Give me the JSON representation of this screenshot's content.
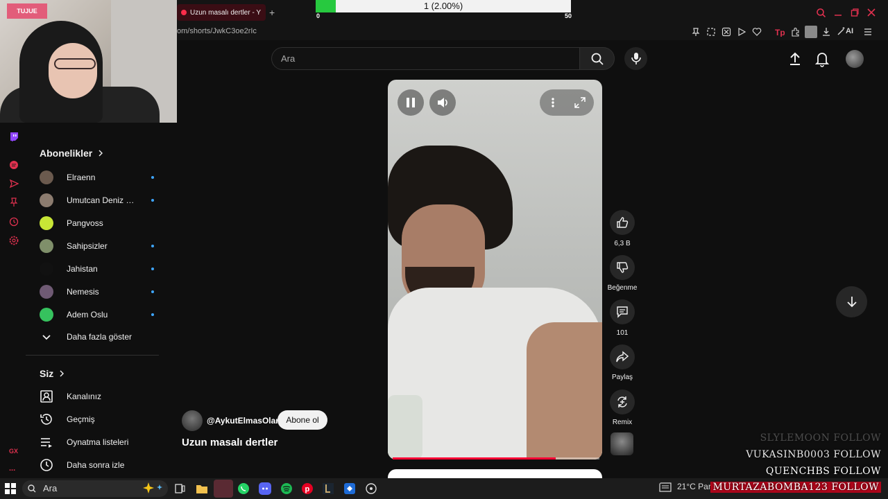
{
  "browser": {
    "tab_title": "Uzun masalı dertler - Y",
    "new_tab_symbol": "+",
    "url": "om/shorts/JwkC3oe2rIc",
    "ai_label": "AI"
  },
  "stream_goal": {
    "text": "1 (2.00%)",
    "min_label": "0",
    "max_label": "50",
    "progress_fraction": 0.02
  },
  "yt_header": {
    "search_placeholder": "Ara"
  },
  "sidebar": {
    "subscriptions_title": "Abonelikler",
    "subscriptions": [
      {
        "name": "Elraenn",
        "new": true,
        "color": "#6b5a4e"
      },
      {
        "name": "Umutcan Deniz İl...",
        "new": true,
        "color": "#8c7c6f"
      },
      {
        "name": "Pangvoss",
        "new": false,
        "color": "#c8e636"
      },
      {
        "name": "Sahipsizler",
        "new": true,
        "color": "#7f8f6a"
      },
      {
        "name": "Jahistan",
        "new": true,
        "color": "#111111"
      },
      {
        "name": "Nemesis",
        "new": true,
        "color": "#6f5a74"
      },
      {
        "name": "Adem Oslu",
        "new": true,
        "color": "#36c25e"
      }
    ],
    "show_more": "Daha fazla göster",
    "you_title": "Siz",
    "you_items": [
      {
        "label": "Kanalınız",
        "icon": "channel-icon"
      },
      {
        "label": "Geçmiş",
        "icon": "history-icon"
      },
      {
        "label": "Oynatma listeleri",
        "icon": "playlists-icon"
      },
      {
        "label": "Daha sonra izle",
        "icon": "watch-later-icon"
      }
    ]
  },
  "video": {
    "channel": "@AykutElmasOlan",
    "subscribe_label": "Abone ol",
    "title": "Uzun masalı dertler",
    "progress_fraction": 0.79
  },
  "actions": {
    "likes": "6,3 B",
    "dislike_label": "Beğenme",
    "comments": "101",
    "share_label": "Paylaş",
    "remix_label": "Remix"
  },
  "follow_alerts": [
    "SLYLEMOON  FOLLOW",
    "VUKASINB0003  FOLLOW",
    "QUENCHBS  FOLLOW",
    "MURTAZABOMBA123  FOLLOW"
  ],
  "taskbar": {
    "search_placeholder": "Ara",
    "weather": "21°C  Parçalı"
  },
  "side_panel": {
    "gx_label": "GX",
    "more_label": "..."
  }
}
